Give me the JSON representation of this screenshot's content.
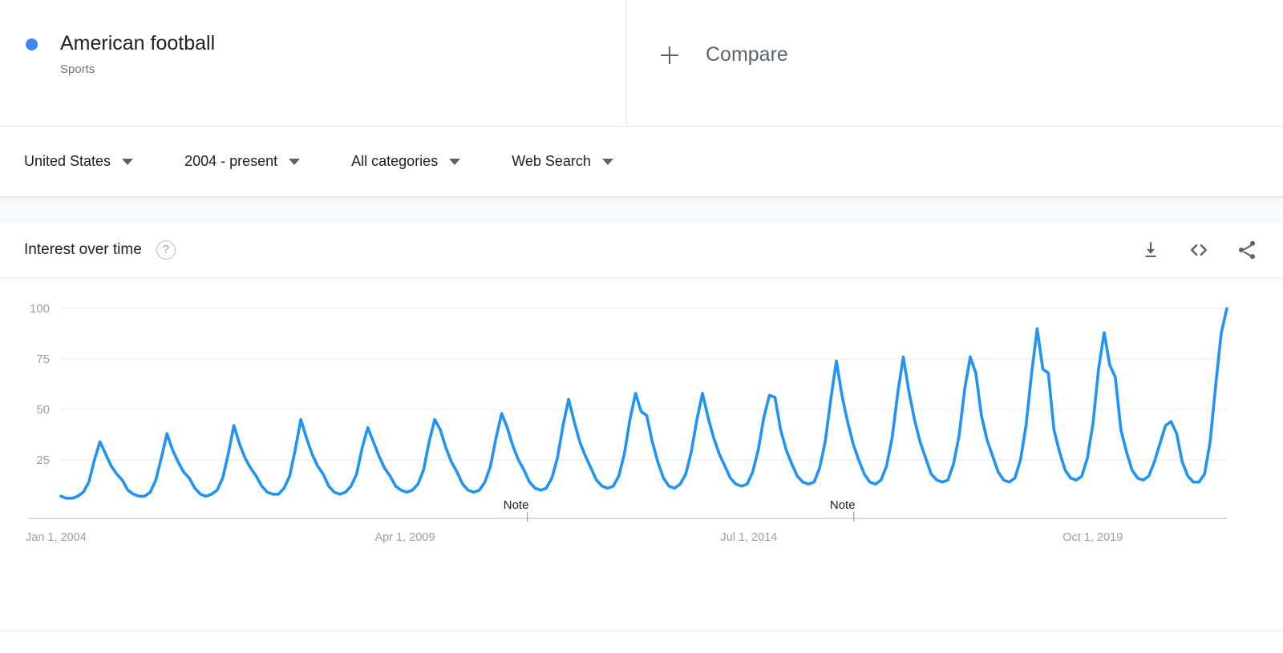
{
  "term": {
    "name": "American football",
    "category": "Sports",
    "dot_color": "#4285f4"
  },
  "compare": {
    "label": "Compare",
    "icon": "plus-icon"
  },
  "filters": [
    {
      "label": "United States",
      "icon": "chevron-down-icon"
    },
    {
      "label": "2004 - present",
      "icon": "chevron-down-icon"
    },
    {
      "label": "All categories",
      "icon": "chevron-down-icon"
    },
    {
      "label": "Web Search",
      "icon": "chevron-down-icon"
    }
  ],
  "card": {
    "title": "Interest over time",
    "help_icon": "help-circle-icon",
    "help_glyph": "?",
    "actions": [
      {
        "name": "download-icon",
        "title": "Download"
      },
      {
        "name": "embed-code-icon",
        "title": "Embed"
      },
      {
        "name": "share-icon",
        "title": "Share"
      }
    ]
  },
  "chart_data": {
    "type": "line",
    "title": "Interest over time",
    "xlabel": "",
    "ylabel": "",
    "ylim": [
      0,
      100
    ],
    "yticks": [
      100,
      75,
      50,
      25
    ],
    "grid": true,
    "legend_position": "top-left",
    "line_color": "#1f94f5",
    "series": [
      {
        "name": "American football",
        "values": [
          7,
          6,
          6,
          7,
          9,
          14,
          25,
          34,
          28,
          22,
          18,
          15,
          10,
          8,
          7,
          7,
          9,
          15,
          26,
          38,
          30,
          24,
          19,
          16,
          11,
          8,
          7,
          8,
          10,
          16,
          28,
          42,
          33,
          26,
          21,
          17,
          12,
          9,
          8,
          8,
          11,
          17,
          30,
          45,
          36,
          28,
          22,
          18,
          12,
          9,
          8,
          9,
          12,
          18,
          31,
          41,
          34,
          27,
          21,
          17,
          12,
          10,
          9,
          10,
          13,
          20,
          34,
          45,
          40,
          31,
          24,
          19,
          13,
          10,
          9,
          10,
          14,
          22,
          36,
          48,
          41,
          32,
          25,
          20,
          14,
          11,
          10,
          11,
          16,
          26,
          42,
          55,
          44,
          34,
          27,
          21,
          15,
          12,
          11,
          12,
          17,
          28,
          45,
          58,
          49,
          47,
          34,
          24,
          16,
          12,
          11,
          13,
          18,
          29,
          45,
          58,
          46,
          36,
          28,
          22,
          16,
          13,
          12,
          13,
          19,
          30,
          46,
          57,
          56,
          40,
          30,
          23,
          17,
          14,
          13,
          14,
          21,
          34,
          55,
          74,
          57,
          44,
          33,
          25,
          18,
          14,
          13,
          15,
          22,
          36,
          58,
          76,
          59,
          45,
          34,
          26,
          18,
          15,
          14,
          15,
          23,
          37,
          60,
          76,
          68,
          47,
          35,
          27,
          19,
          15,
          14,
          16,
          25,
          42,
          68,
          90,
          70,
          68,
          40,
          29,
          20,
          16,
          15,
          17,
          26,
          43,
          70,
          88,
          72,
          66,
          40,
          29,
          20,
          16,
          15,
          17,
          24,
          33,
          42,
          44,
          38,
          24,
          17,
          14,
          14,
          18,
          34,
          62,
          88,
          100
        ],
        "peak_years": [
          2004,
          2005,
          2006,
          2007,
          2008,
          2009,
          2010,
          2011,
          2012,
          2013,
          2014,
          2015,
          2016,
          2017,
          2018,
          2019,
          2020,
          2021
        ],
        "peak_values": [
          34,
          38,
          42,
          45,
          41,
          45,
          48,
          55,
          58,
          58,
          57,
          74,
          76,
          76,
          90,
          88,
          44,
          100
        ],
        "max_value": 100
      }
    ],
    "xticks": [
      {
        "label": "Jan 1, 2004",
        "pos": 0.0
      },
      {
        "label": "Apr 1, 2009",
        "pos": 0.295
      },
      {
        "label": "Jul 1, 2014",
        "pos": 0.59
      },
      {
        "label": "Oct 1, 2019",
        "pos": 0.885
      }
    ],
    "notes": [
      {
        "label": "Note",
        "pos": 0.4
      },
      {
        "label": "Note",
        "pos": 0.68
      }
    ]
  }
}
